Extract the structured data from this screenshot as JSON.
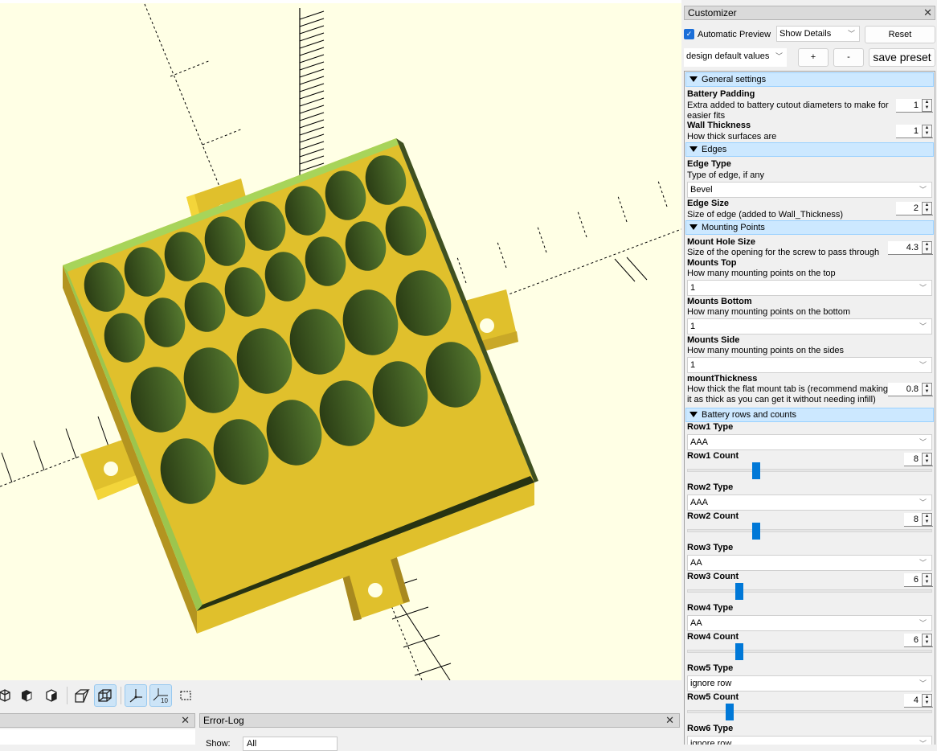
{
  "viewport": {
    "background": "#ffffe5",
    "model_colors": {
      "top": "#e0c02c",
      "side": "#c9a827",
      "edge_highlight": "#a7d45a",
      "hole": "#3c5620",
      "dark_edge": "#273312"
    }
  },
  "toolbar": {
    "buttons": [
      {
        "name": "view-left-icon",
        "active": false
      },
      {
        "name": "view-front-icon",
        "active": false
      },
      {
        "name": "view-back-icon",
        "active": false
      },
      {
        "name": "perspective-icon",
        "active": false
      },
      {
        "name": "orthogonal-icon",
        "active": true
      },
      {
        "name": "show-axes-icon",
        "active": true
      },
      {
        "name": "show-scale-markers-icon",
        "active": true,
        "label": "10"
      },
      {
        "name": "show-edges-icon",
        "active": false
      }
    ]
  },
  "console": {
    "close": "✕"
  },
  "errorlog": {
    "title": "Error-Log",
    "close": "✕",
    "show_label": "Show:",
    "show_value": "All"
  },
  "customizer": {
    "title": "Customizer",
    "close": "✕",
    "automatic_preview_label": "Automatic Preview",
    "automatic_preview_checked": true,
    "details_select": "Show Details",
    "reset_label": "Reset",
    "preset_select": "design default values",
    "add_preset_label": "+",
    "remove_preset_label": "-",
    "save_preset_label": "save preset",
    "groups": {
      "general": "General settings",
      "edges": "Edges",
      "mounting": "Mounting Points",
      "battery": "Battery rows and counts"
    },
    "params": {
      "battery_padding": {
        "name": "Battery Padding",
        "desc": "Extra added to battery cutout diameters to make for easier fits",
        "value": "1"
      },
      "wall_thickness": {
        "name": "Wall Thickness",
        "desc": "How thick surfaces are",
        "value": "1"
      },
      "edge_type": {
        "name": "Edge Type",
        "desc": "Type of edge, if any",
        "value": "Bevel"
      },
      "edge_size": {
        "name": "Edge Size",
        "desc": "Size of edge (added to Wall_Thickness)",
        "value": "2"
      },
      "mount_hole_size": {
        "name": "Mount Hole Size",
        "desc": "Size of the opening for the screw to pass through",
        "value": "4.3"
      },
      "mounts_top": {
        "name": "Mounts Top",
        "desc": "How many mounting points on the top",
        "value": "1"
      },
      "mounts_bottom": {
        "name": "Mounts Bottom",
        "desc": "How many mounting points on the bottom",
        "value": "1"
      },
      "mounts_side": {
        "name": "Mounts Side",
        "desc": "How many mounting points on the sides",
        "value": "1"
      },
      "mount_thickness": {
        "name": "mountThickness",
        "desc": "How thick the flat mount tab is (recommend making it as thick as you can get it without needing infill)",
        "value": "0.8"
      }
    },
    "rows": [
      {
        "type_label": "Row1 Type",
        "type_value": "AAA",
        "count_label": "Row1 Count",
        "count_value": "8",
        "slider_fraction": 0.27
      },
      {
        "type_label": "Row2 Type",
        "type_value": "AAA",
        "count_label": "Row2 Count",
        "count_value": "8",
        "slider_fraction": 0.27
      },
      {
        "type_label": "Row3 Type",
        "type_value": "AA",
        "count_label": "Row3 Count",
        "count_value": "6",
        "slider_fraction": 0.2
      },
      {
        "type_label": "Row4 Type",
        "type_value": "AA",
        "count_label": "Row4 Count",
        "count_value": "6",
        "slider_fraction": 0.2
      },
      {
        "type_label": "Row5 Type",
        "type_value": "ignore row",
        "count_label": "Row5 Count",
        "count_value": "4",
        "slider_fraction": 0.16
      },
      {
        "type_label": "Row6 Type",
        "type_value": "ignore row"
      }
    ]
  }
}
